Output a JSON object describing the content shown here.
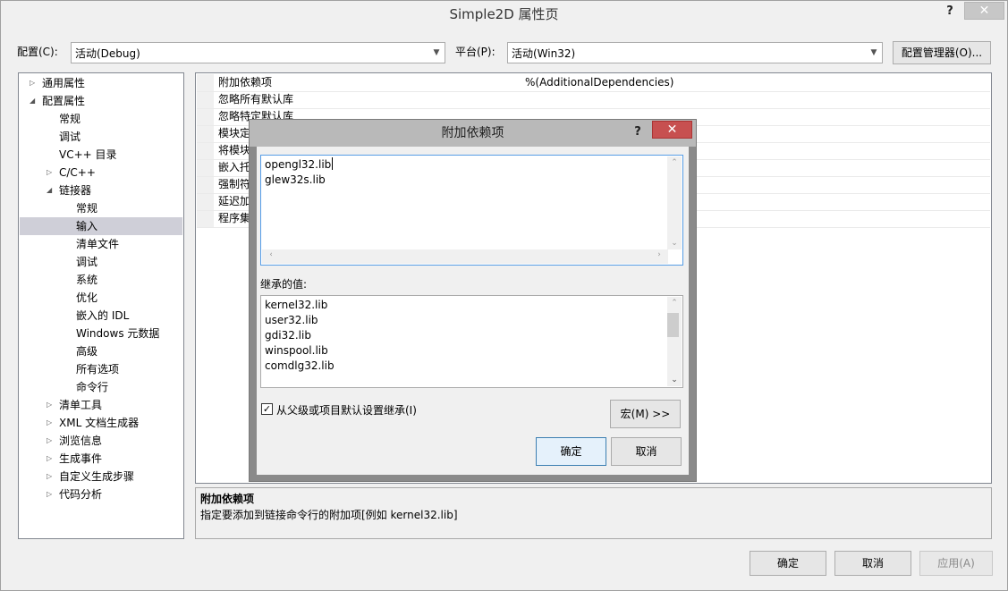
{
  "window": {
    "title": "Simple2D 属性页",
    "help": "?",
    "close": "✕"
  },
  "config": {
    "label": "配置(C):",
    "value": "活动(Debug)",
    "platform_label": "平台(P):",
    "platform_value": "活动(Win32)",
    "manager_button": "配置管理器(O)..."
  },
  "tree": {
    "items": [
      {
        "label": "通用属性",
        "exp": "▷"
      },
      {
        "label": "配置属性",
        "exp": "◢"
      },
      {
        "label": "常规",
        "exp": ""
      },
      {
        "label": "调试",
        "exp": ""
      },
      {
        "label": "VC++ 目录",
        "exp": ""
      },
      {
        "label": "C/C++",
        "exp": "▷"
      },
      {
        "label": "链接器",
        "exp": "◢"
      },
      {
        "label": "常规",
        "exp": ""
      },
      {
        "label": "输入",
        "exp": ""
      },
      {
        "label": "清单文件",
        "exp": ""
      },
      {
        "label": "调试",
        "exp": ""
      },
      {
        "label": "系统",
        "exp": ""
      },
      {
        "label": "优化",
        "exp": ""
      },
      {
        "label": "嵌入的 IDL",
        "exp": ""
      },
      {
        "label": "Windows 元数据",
        "exp": ""
      },
      {
        "label": "高级",
        "exp": ""
      },
      {
        "label": "所有选项",
        "exp": ""
      },
      {
        "label": "命令行",
        "exp": ""
      },
      {
        "label": "清单工具",
        "exp": "▷"
      },
      {
        "label": "XML 文档生成器",
        "exp": "▷"
      },
      {
        "label": "浏览信息",
        "exp": "▷"
      },
      {
        "label": "生成事件",
        "exp": "▷"
      },
      {
        "label": "自定义生成步骤",
        "exp": "▷"
      },
      {
        "label": "代码分析",
        "exp": "▷"
      }
    ]
  },
  "grid": {
    "rows": [
      {
        "name": "附加依赖项",
        "value": "%(AdditionalDependencies)"
      },
      {
        "name": "忽略所有默认库",
        "value": ""
      },
      {
        "name": "忽略特定默认库",
        "value": ""
      },
      {
        "name": "模块定",
        "value": ""
      },
      {
        "name": "将模块",
        "value": ""
      },
      {
        "name": "嵌入托",
        "value": ""
      },
      {
        "name": "强制符",
        "value": ""
      },
      {
        "name": "延迟加",
        "value": ""
      },
      {
        "name": "程序集",
        "value": ""
      }
    ]
  },
  "description": {
    "title": "附加依赖项",
    "text": "指定要添加到链接命令行的附加项[例如 kernel32.lib]"
  },
  "dialog": {
    "title": "附加依赖项",
    "help": "?",
    "close": "✕",
    "edit_lines": [
      "opengl32.lib",
      "glew32s.lib"
    ],
    "inherited_label": "继承的值:",
    "inherited_lines": [
      "kernel32.lib",
      "user32.lib",
      "gdi32.lib",
      "winspool.lib",
      "comdlg32.lib"
    ],
    "inherit_checkbox_label": "从父级或项目默认设置继承(I)",
    "inherit_checked": true,
    "macro_button": "宏(M) >>",
    "ok": "确定",
    "cancel": "取消"
  },
  "footer": {
    "ok": "确定",
    "cancel": "取消",
    "apply": "应用(A)"
  }
}
